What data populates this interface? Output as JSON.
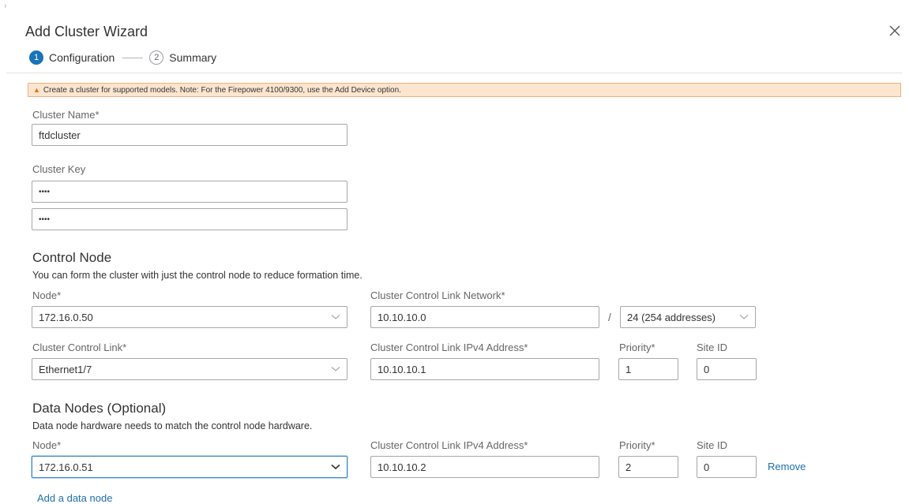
{
  "corner_mark": "r",
  "wizard": {
    "title": "Add Cluster Wizard",
    "steps": [
      {
        "number": "1",
        "label": "Configuration",
        "active": true
      },
      {
        "number": "2",
        "label": "Summary",
        "active": false
      }
    ]
  },
  "alert": {
    "icon": "warning-triangle-icon",
    "text": "Create a cluster for supported models. Note: For the Firepower 4100/9300, use the Add Device option."
  },
  "cluster": {
    "name_label": "Cluster Name*",
    "name_value": "ftdcluster",
    "key_label": "Cluster Key",
    "key_value": "••••",
    "key_confirm_value": "••••"
  },
  "control_node": {
    "heading": "Control Node",
    "description": "You can form the cluster with just the control node to reduce formation time.",
    "node_label": "Node*",
    "node_value": "172.16.0.50",
    "ccl_network_label": "Cluster Control Link Network*",
    "ccl_network_value": "10.10.10.0",
    "slash": "/",
    "prefix_value": "24 (254 addresses)",
    "ccl_label": "Cluster Control Link*",
    "ccl_value": "Ethernet1/7",
    "ccl_ipv4_label": "Cluster Control Link IPv4 Address*",
    "ccl_ipv4_value": "10.10.10.1",
    "priority_label": "Priority*",
    "priority_value": "1",
    "site_id_label": "Site ID",
    "site_id_value": "0"
  },
  "data_nodes": {
    "heading": "Data Nodes (Optional)",
    "description": "Data node hardware needs to match the control node hardware.",
    "node_label": "Node*",
    "ccl_ipv4_label": "Cluster Control Link IPv4 Address*",
    "priority_label": "Priority*",
    "site_id_label": "Site ID",
    "rows": [
      {
        "node": "172.16.0.51",
        "ccl_ipv4": "10.10.10.2",
        "priority": "2",
        "site_id": "0",
        "remove_label": "Remove"
      }
    ],
    "add_label": "Add a data node"
  },
  "colors": {
    "accent": "#1a73b8",
    "link": "#1d70b0",
    "alert_bg": "#fde5cf",
    "alert_border": "#f0b27a",
    "warning": "#e8710a"
  }
}
